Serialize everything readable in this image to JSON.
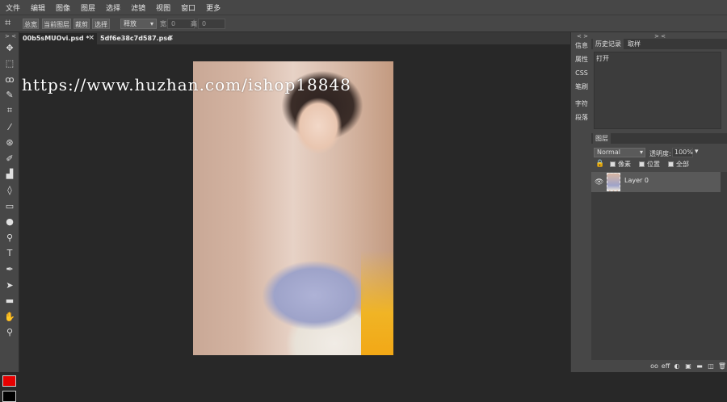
{
  "menu": [
    "文件",
    "编辑",
    "图像",
    "图层",
    "选择",
    "滤镜",
    "视图",
    "窗口",
    "更多"
  ],
  "options": {
    "crop_icon": "crop-icon",
    "buttons": [
      "总宽",
      "当前图层",
      "裁剪",
      "选择"
    ],
    "mode_select": "释放",
    "width_label": "宽",
    "width_value": "0",
    "height_label": "高",
    "height_value": "0"
  },
  "toolbox": {
    "collapse": "> <",
    "tools": [
      {
        "name": "move-tool",
        "glyph": "✥"
      },
      {
        "name": "marquee-tool",
        "glyph": "⬚"
      },
      {
        "name": "lasso-tool",
        "glyph": "ꝏ"
      },
      {
        "name": "quick-select-tool",
        "glyph": "✎"
      },
      {
        "name": "crop-tool",
        "glyph": "⌗"
      },
      {
        "name": "eyedropper-tool",
        "glyph": "⁄"
      },
      {
        "name": "healing-tool",
        "glyph": "⊛"
      },
      {
        "name": "brush-tool",
        "glyph": "✐"
      },
      {
        "name": "clone-stamp-tool",
        "glyph": "▟"
      },
      {
        "name": "eraser-tool",
        "glyph": "◊"
      },
      {
        "name": "gradient-tool",
        "glyph": "▭"
      },
      {
        "name": "blur-tool",
        "glyph": "●"
      },
      {
        "name": "dodge-tool",
        "glyph": "⚲"
      },
      {
        "name": "text-tool",
        "glyph": "T"
      },
      {
        "name": "pen-tool",
        "glyph": "✒"
      },
      {
        "name": "path-select-tool",
        "glyph": "➤"
      },
      {
        "name": "shape-tool",
        "glyph": "▬"
      },
      {
        "name": "hand-tool",
        "glyph": "✋"
      },
      {
        "name": "zoom-tool",
        "glyph": "⚲"
      }
    ],
    "fg_color": "#e60000",
    "bg_color": "#000000"
  },
  "tabs": [
    {
      "label": "00b5sMUOvi.psd *",
      "close": "×"
    },
    {
      "label": "5df6e38c7d587.psd",
      "close": "×"
    }
  ],
  "watermark": "https://www.huzhan.com/ishop18848",
  "side_buttons": {
    "collapse": "< >",
    "items": [
      "信息",
      "属性",
      "CSS",
      "笔刷",
      "字符",
      "段落"
    ]
  },
  "right_panel": {
    "collapse": "> <",
    "tabs": [
      "历史记录",
      "取样"
    ],
    "history_items": [
      "打开"
    ],
    "layers_tab": "图层",
    "blend_mode": "Normal",
    "opacity_label": "透明度:",
    "opacity_value": "100%",
    "lock_options": [
      "像素",
      "位置",
      "全部"
    ],
    "layers": [
      {
        "name": "Layer 0"
      }
    ],
    "bottom_icons": [
      "oo",
      "eff",
      "◐",
      "▣",
      "▬",
      "◫",
      "🗑"
    ]
  }
}
